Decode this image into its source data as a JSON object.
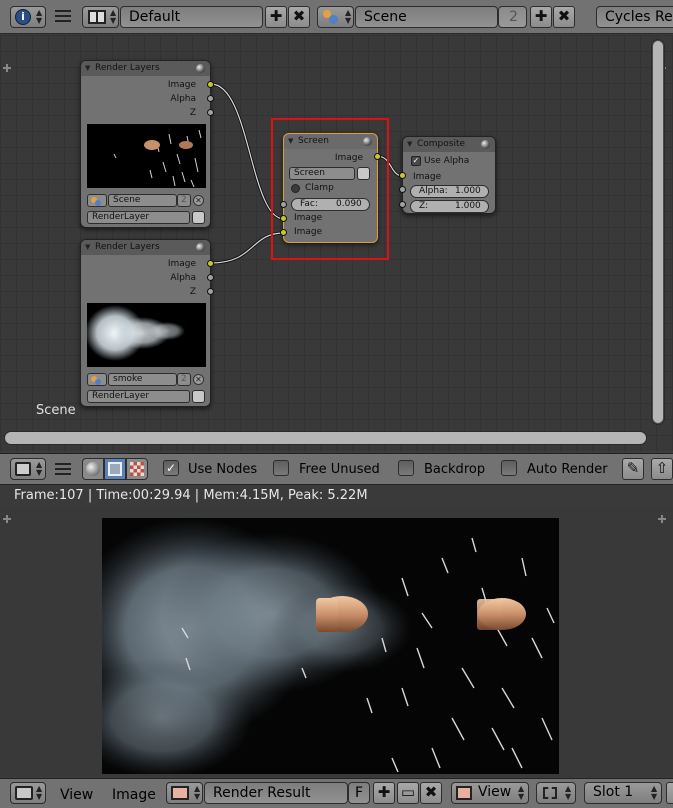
{
  "top_header": {
    "screen_layout": "Default",
    "scene_name": "Scene",
    "scene_users": "2",
    "render_engine": "Cycles Ren"
  },
  "node_editor": {
    "scene_label": "Scene",
    "nodes": {
      "render_layers_1": {
        "title": "Render Layers",
        "outputs": [
          "Image",
          "Alpha",
          "Z"
        ],
        "scene": "Scene",
        "scene_users": "2",
        "layer": "RenderLayer"
      },
      "render_layers_2": {
        "title": "Render Layers",
        "outputs": [
          "Image",
          "Alpha",
          "Z"
        ],
        "scene": "smoke",
        "scene_users": "2",
        "layer": "RenderLayer"
      },
      "mix_screen": {
        "title": "Screen",
        "output": "Image",
        "blend_mode": "Screen",
        "clamp_label": "Clamp",
        "fac_label": "Fac:",
        "fac_value": "0.090",
        "inputs": [
          "Image",
          "Image"
        ]
      },
      "composite": {
        "title": "Composite",
        "use_alpha_label": "Use Alpha",
        "input_image": "Image",
        "alpha_label": "Alpha:",
        "alpha_value": "1.000",
        "z_label": "Z:",
        "z_value": "1.000"
      }
    }
  },
  "node_toolbar": {
    "use_nodes": "Use Nodes",
    "free_unused": "Free Unused",
    "backdrop": "Backdrop",
    "auto_render": "Auto Render"
  },
  "image_editor": {
    "info": "Frame:107 | Time:00:29.94 | Mem:4.15M, Peak: 5.22M"
  },
  "bottom_header": {
    "menu_view": "View",
    "menu_image": "Image",
    "image_name": "Render Result",
    "fake_user": "F",
    "view_mode": "View",
    "slot": "Slot 1"
  }
}
